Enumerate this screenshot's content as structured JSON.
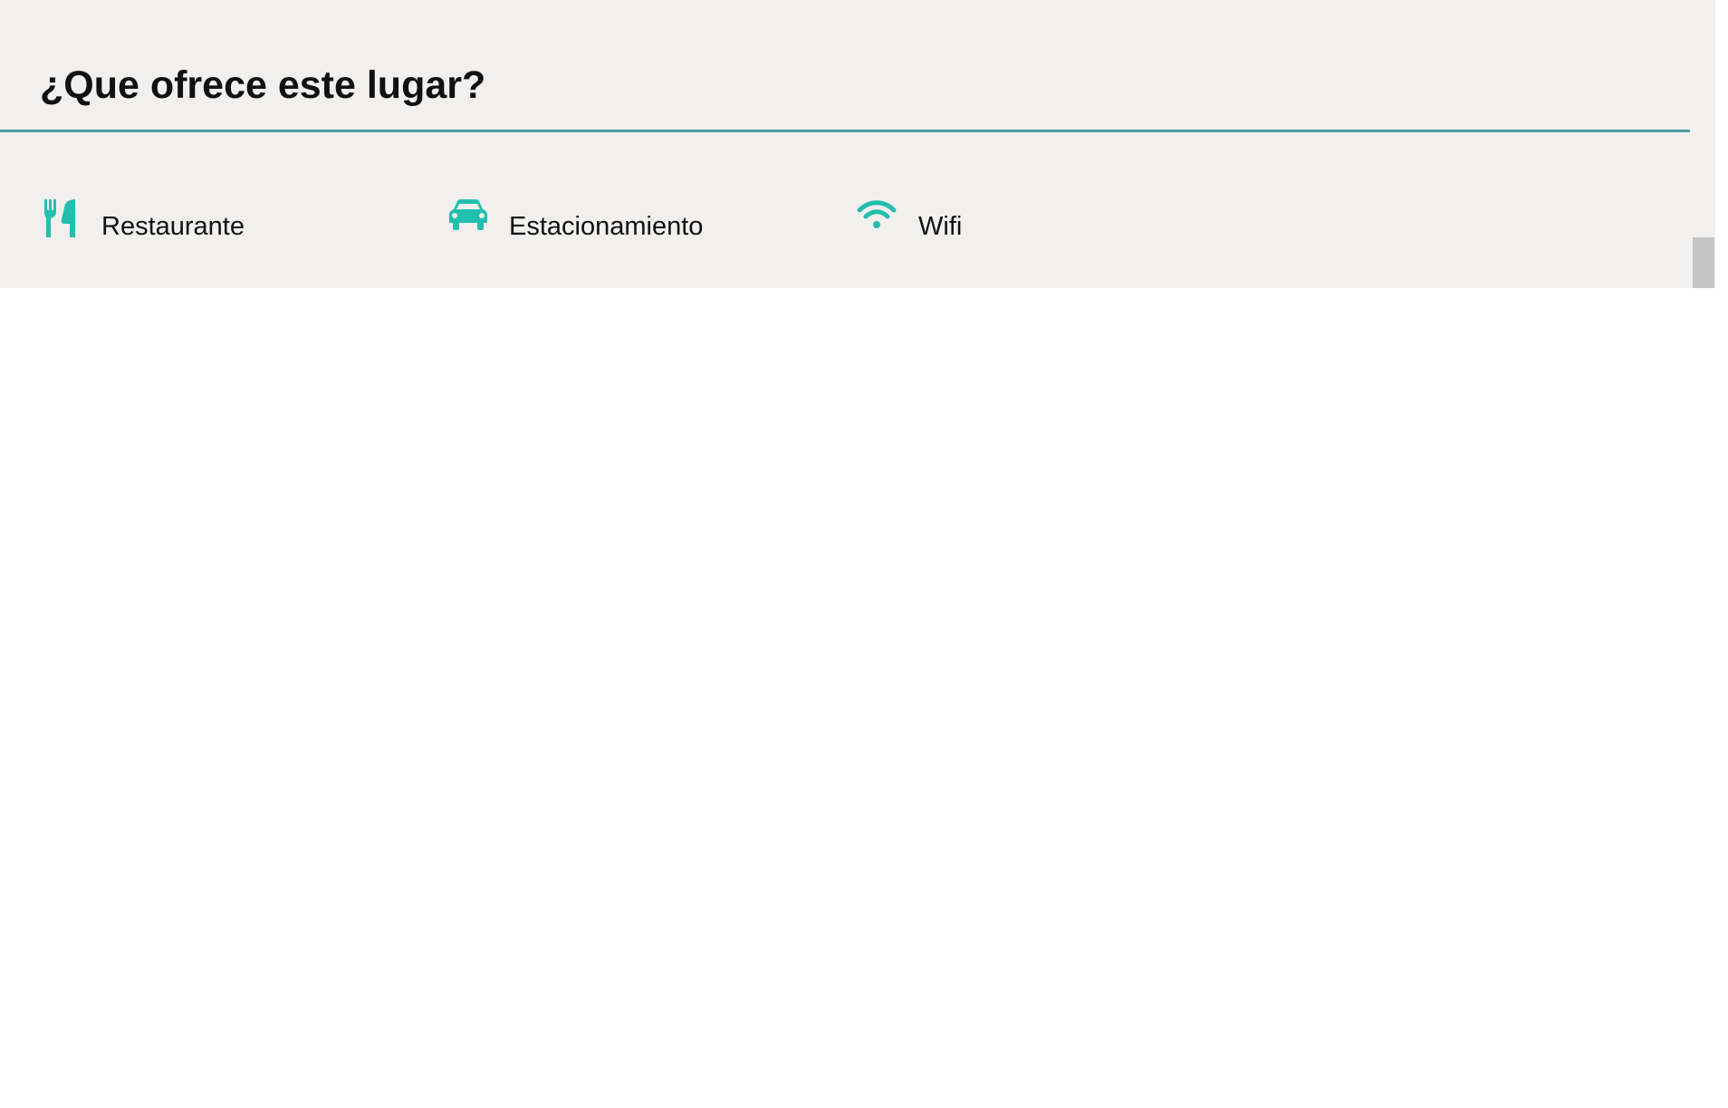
{
  "section": {
    "title": "¿Que ofrece este lugar?"
  },
  "amenities": [
    {
      "icon": "utensils-icon",
      "label": "Restaurante"
    },
    {
      "icon": "car-icon",
      "label": "Estacionamiento"
    },
    {
      "icon": "wifi-icon",
      "label": "Wifi"
    }
  ],
  "colors": {
    "accent": "#23bfae",
    "divider": "#4f9da6",
    "panel_background": "#f1f0ee"
  }
}
